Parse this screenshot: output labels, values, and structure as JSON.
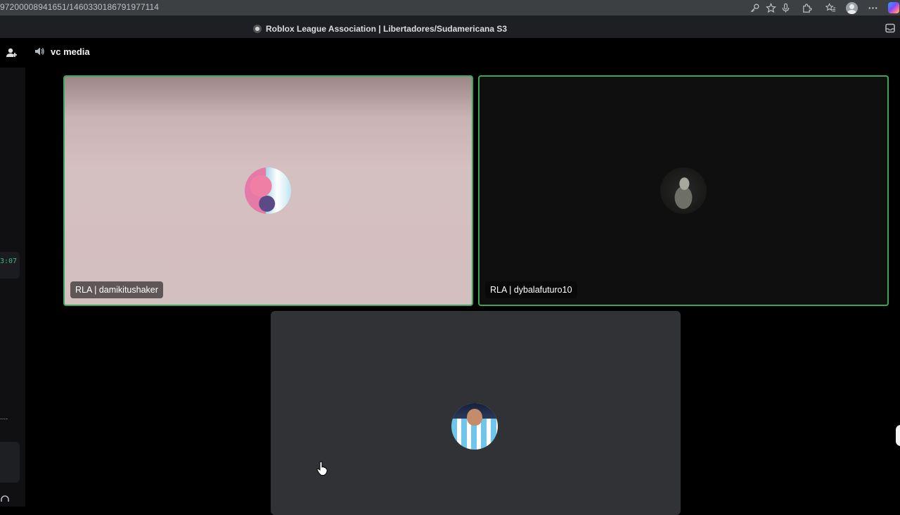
{
  "browser": {
    "url": "97200089416511460330186791977114",
    "url_display": "97200008941651/1460330186791977114",
    "icons": [
      "key-icon",
      "star-icon",
      "microphone-icon",
      "extensions-icon",
      "favorites-icon",
      "profile-avatar",
      "more-icon",
      "copilot-icon"
    ]
  },
  "title_bar": {
    "title": "Roblox League Association | Libertadores/Sudamericana S3"
  },
  "sidebar": {
    "timer": "3:07",
    "ellipsis": "...."
  },
  "channel": {
    "name": "vc media"
  },
  "participants": [
    {
      "name": "RLA | damikitushaker",
      "speaking": true,
      "avatar": "pink-hair-anime-avatar"
    },
    {
      "name": "RLA | dybalafuturo10",
      "speaking": true,
      "avatar": "statue-avatar"
    },
    {
      "name": "",
      "speaking": false,
      "avatar": "football-player-avatar"
    }
  ],
  "colors": {
    "speaking_border": "#3ba55c",
    "background": "#000000",
    "tile_dark": "#0f0f0f",
    "tile_grey": "#313236",
    "tile_pink": "#d3bec0"
  }
}
